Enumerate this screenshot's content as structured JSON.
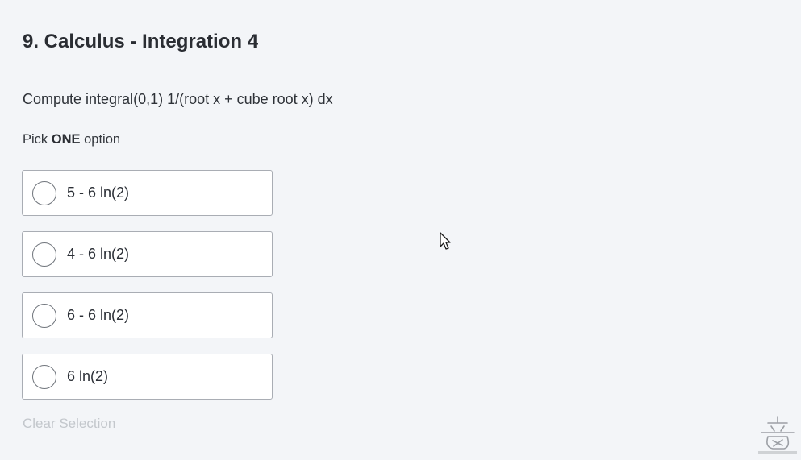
{
  "question": {
    "title": "9. Calculus - Integration 4",
    "prompt": "Compute integral(0,1) 1/(root x + cube root x) dx",
    "instruction_prefix": "Pick ",
    "instruction_emphasis": "ONE",
    "instruction_suffix": " option"
  },
  "options": [
    {
      "label": "5 - 6 ln(2)",
      "selected": false
    },
    {
      "label": "4 - 6 ln(2)",
      "selected": false
    },
    {
      "label": "6 - 6 ln(2)",
      "selected": false
    },
    {
      "label": "6 ln(2)",
      "selected": false
    }
  ],
  "clear_selection_label": "Clear Selection",
  "icons": {
    "cursor": "mouse-pointer-icon",
    "watermark": "watermark-logo-icon"
  },
  "colors": {
    "background": "#f3f5f8",
    "option_border": "#a9adb4",
    "clear_text": "#c3c7cc"
  }
}
